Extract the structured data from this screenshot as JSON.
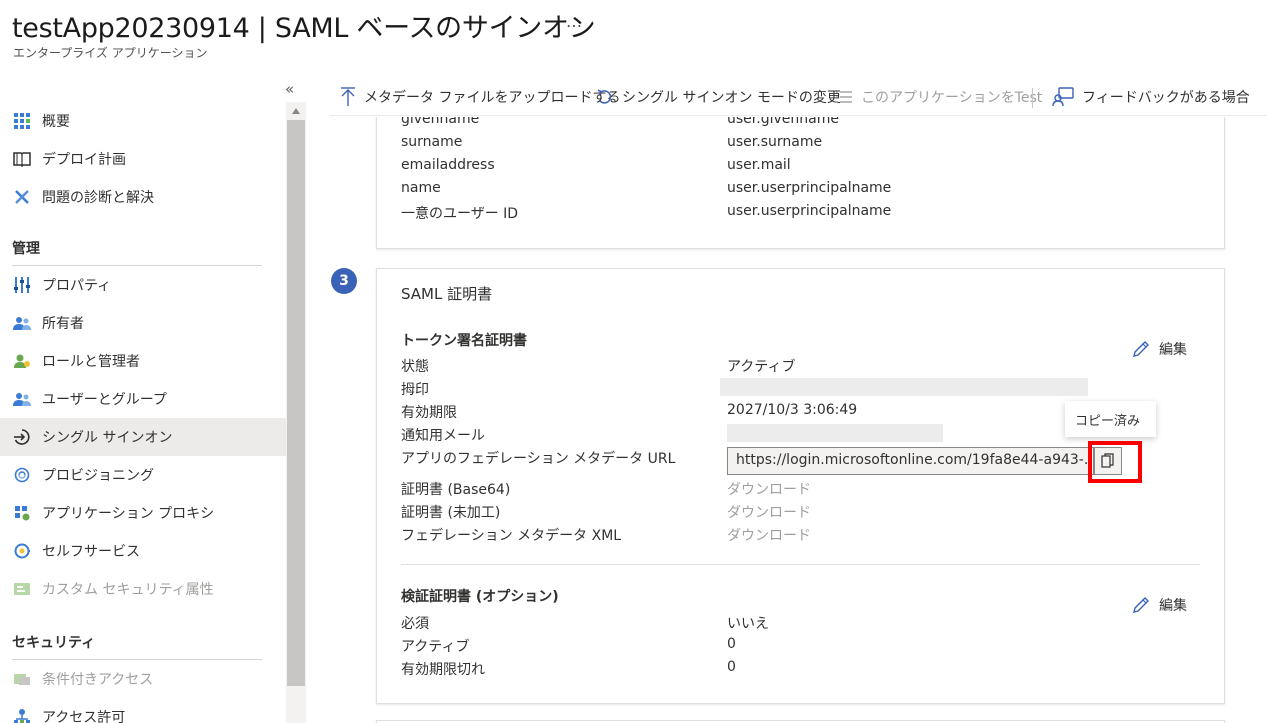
{
  "header": {
    "title": "testApp20230914 | SAML ベースのサインオン",
    "ellipsis": "…",
    "subtitle": "エンタープライズ アプリケーション"
  },
  "sidebar": {
    "collapse": "«",
    "items": [
      {
        "label": "概要",
        "icon": "grid-icon"
      },
      {
        "label": "デプロイ計画",
        "icon": "book-icon"
      },
      {
        "label": "問題の診断と解決",
        "icon": "wrench-icon"
      }
    ],
    "section_manage": "管理",
    "manage_items": [
      {
        "label": "プロパティ",
        "icon": "properties-icon"
      },
      {
        "label": "所有者",
        "icon": "owners-icon"
      },
      {
        "label": "ロールと管理者",
        "icon": "roles-icon"
      },
      {
        "label": "ユーザーとグループ",
        "icon": "users-icon"
      },
      {
        "label": "シングル サインオン",
        "icon": "sso-icon"
      },
      {
        "label": "プロビジョニング",
        "icon": "provisioning-icon"
      },
      {
        "label": "アプリケーション プロキシ",
        "icon": "proxy-icon"
      },
      {
        "label": "セルフサービス",
        "icon": "selfservice-icon"
      },
      {
        "label": "カスタム セキュリティ属性",
        "icon": "custom-attr-icon"
      }
    ],
    "section_security": "セキュリティ",
    "security_items": [
      {
        "label": "条件付きアクセス",
        "icon": "conditional-access-icon"
      },
      {
        "label": "アクセス許可",
        "icon": "permissions-icon"
      }
    ]
  },
  "toolbar": {
    "upload": "メタデータ ファイルをアップロードする",
    "change_mode": "シングル サインオン モードの変更",
    "test": "このアプリケーションをTest",
    "feedback": "フィードバックがある場合"
  },
  "attributes": {
    "rows": [
      {
        "name": "givenname",
        "value": "user.givenname"
      },
      {
        "name": "surname",
        "value": "user.surname"
      },
      {
        "name": "emailaddress",
        "value": "user.mail"
      },
      {
        "name": "name",
        "value": "user.userprincipalname"
      },
      {
        "name": "一意のユーザー ID",
        "value": "user.userprincipalname"
      }
    ]
  },
  "saml_cert": {
    "step": "3",
    "title": "SAML 証明書",
    "token_heading": "トークン署名証明書",
    "edit": "編集",
    "status_label": "状態",
    "status_value": "アクティブ",
    "thumbprint_label": "拇印",
    "expiry_label": "有効期限",
    "expiry_value": "2027/10/3 3:06:49",
    "notify_label": "通知用メール",
    "metadata_url_label": "アプリのフェデレーション メタデータ URL",
    "metadata_url_value": "https://login.microsoftonline.com/19fa8e44-a943-...",
    "copy_tooltip": "コピー済み",
    "cert_base64_label": "証明書 (Base64)",
    "cert_raw_label": "証明書 (未加工)",
    "fed_xml_label": "フェデレーション メタデータ XML",
    "download": "ダウンロード",
    "verify_heading": "検証証明書 (オプション)",
    "required_label": "必須",
    "required_value": "いいえ",
    "active_label": "アクティブ",
    "active_value": "0",
    "expired_label": "有効期限切れ",
    "expired_value": "0"
  }
}
